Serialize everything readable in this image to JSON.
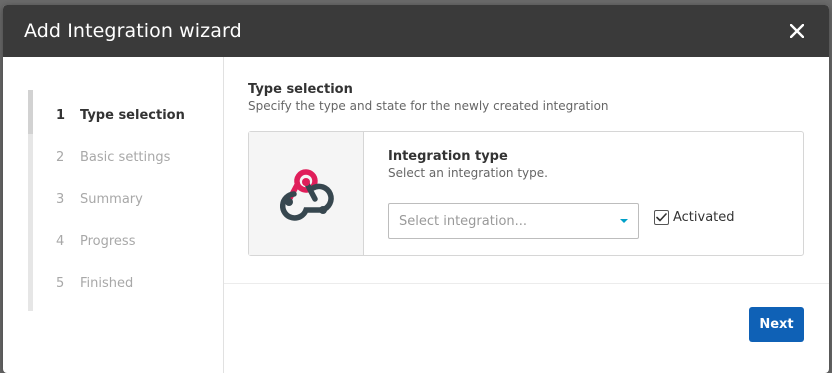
{
  "dialog": {
    "title": "Add Integration wizard",
    "close_icon": "close-icon"
  },
  "stepper": {
    "steps": [
      {
        "number": "1",
        "label": "Type selection",
        "state": "active"
      },
      {
        "number": "2",
        "label": "Basic settings",
        "state": "inactive"
      },
      {
        "number": "3",
        "label": "Summary",
        "state": "inactive"
      },
      {
        "number": "4",
        "label": "Progress",
        "state": "inactive"
      },
      {
        "number": "5",
        "label": "Finished",
        "state": "inactive"
      }
    ]
  },
  "content": {
    "title": "Type selection",
    "description": "Specify the type and state for the newly created integration",
    "card": {
      "icon": "webhook-icon",
      "field_label": "Integration type",
      "field_help": "Select an integration type.",
      "select_placeholder": "Select integration...",
      "checkbox_label": "Activated",
      "checkbox_checked": true
    }
  },
  "footer": {
    "next_label": "Next"
  },
  "colors": {
    "header_bg": "#3a3a3a",
    "primary_button": "#0f61b6",
    "webhook_red": "#e01e5a",
    "webhook_dark": "#37474f",
    "select_caret": "#00a0c8"
  }
}
